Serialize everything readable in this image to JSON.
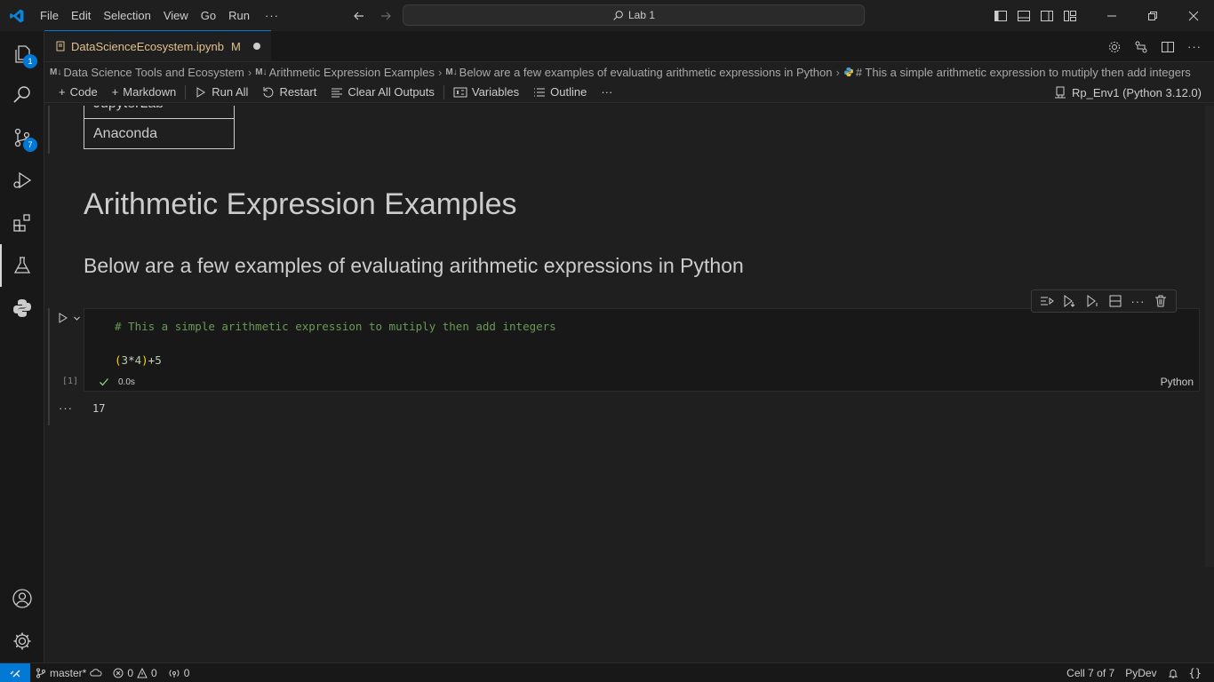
{
  "titlebar": {
    "menu": [
      "File",
      "Edit",
      "Selection",
      "View",
      "Go",
      "Run"
    ],
    "more": "···",
    "search": "Lab 1"
  },
  "activitybar": {
    "explorer_badge": "1",
    "scm_badge": "7"
  },
  "tab": {
    "filename": "DataScienceEcosystem.ipynb",
    "modified_marker": "M"
  },
  "breadcrumb": {
    "md_marker": "M↓",
    "items": [
      "Data Science Tools and Ecosystem",
      "Arithmetic Expression Examples",
      "Below are a few examples of evaluating arithmetic expressions in Python",
      "# This a simple arithmetic expression to mutiply then add integers"
    ]
  },
  "toolbar": {
    "code": "Code",
    "markdown": "Markdown",
    "run_all": "Run All",
    "restart": "Restart",
    "clear_outputs": "Clear All Outputs",
    "variables": "Variables",
    "outline": "Outline",
    "more": "···",
    "kernel": "Rp_Env1 (Python 3.12.0)"
  },
  "notebook": {
    "table_rows": [
      "JupyterLab",
      "Anaconda"
    ],
    "heading1": "Arithmetic Expression Examples",
    "heading2": "Below are a few examples of evaluating arithmetic expressions in Python",
    "code_cell": {
      "comment": "# This a simple arithmetic expression to mutiply then add integers",
      "code_open": "(",
      "code_a": "3",
      "code_mul": "*",
      "code_b": "4",
      "code_close": ")",
      "code_plus": "+",
      "code_c": "5",
      "exec_count": "[1]",
      "duration": "0.0s",
      "language": "Python"
    },
    "output_more": "···",
    "output": "17"
  },
  "statusbar": {
    "branch": "master*",
    "errors": "0",
    "warnings": "0",
    "ports": "0",
    "cell_position": "Cell 7 of 7",
    "interpreter": "PyDev",
    "accent": "#0078d4"
  }
}
